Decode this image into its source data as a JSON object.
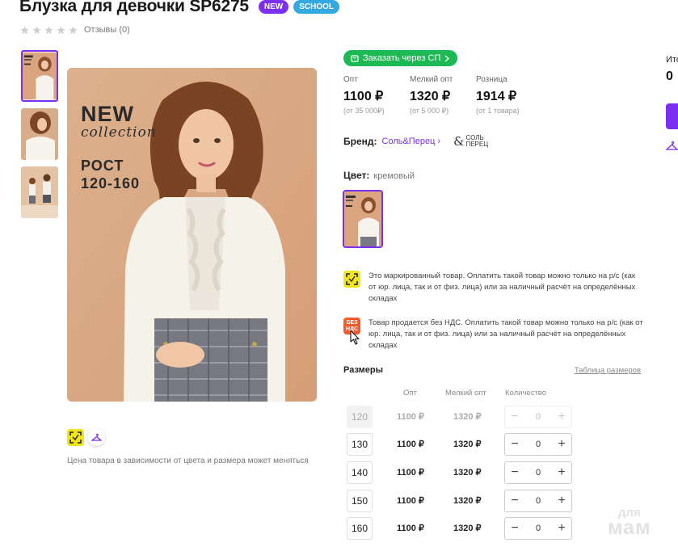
{
  "product": {
    "title": "Блузка для девочки SP6275",
    "badges": {
      "new": "NEW",
      "school": "SCHOOL"
    },
    "reviews": "Отзывы (0)",
    "rating": 0,
    "rating_max": 5
  },
  "photo": {
    "text_new": "NEW",
    "text_collection": "collection",
    "text_rost_1": "РОСТ",
    "text_rost_2": "120-160"
  },
  "gallery": {
    "thumbnail_count": 3,
    "active_index": 0
  },
  "price_note": "Цена товара в зависимости от цвета и размера может меняться",
  "sp_button": "Заказать через СП",
  "prices": [
    {
      "label": "Опт",
      "value": "1100 ₽",
      "sub": "(от 35 000₽)"
    },
    {
      "label": "Мелкий опт",
      "value": "1320 ₽",
      "sub": "(от 5 000 ₽)"
    },
    {
      "label": "Розница",
      "value": "1914 ₽",
      "sub": "(от 1 товара)"
    }
  ],
  "brand": {
    "label": "Бренд:",
    "name": "Соль&Перец",
    "logo_text_1": "СОЛЬ",
    "logo_text_2": "ПЕРЕЦ"
  },
  "color": {
    "label": "Цвет:",
    "value": "кремовый"
  },
  "notices": {
    "marked": "Это маркированный товар. Оплатить такой товар можно только на р/с (как от юр. лица, так и от физ. лица) или за наличный расчёт на определённых складах",
    "no_vat_icon_1": "БЕЗ",
    "no_vat_icon_2": "НДС",
    "no_vat": "Товар продается без НДС. Оплатить такой товар можно только на р/с (как от юр. лица, так и от физ. лица) или за наличный расчёт на определённых складах"
  },
  "sizes": {
    "title": "Размеры",
    "table_link": "Таблица размеров",
    "col_opt": "Опт",
    "col_melk": "Мелкий опт",
    "col_qty": "Количество",
    "rows": [
      {
        "size": "120",
        "opt": "1100 ₽",
        "melk": "1320 ₽",
        "qty": "0",
        "disabled": true
      },
      {
        "size": "130",
        "opt": "1100 ₽",
        "melk": "1320 ₽",
        "qty": "0",
        "disabled": false
      },
      {
        "size": "140",
        "opt": "1100 ₽",
        "melk": "1320 ₽",
        "qty": "0",
        "disabled": false
      },
      {
        "size": "150",
        "opt": "1100 ₽",
        "melk": "1320 ₽",
        "qty": "0",
        "disabled": false
      },
      {
        "size": "160",
        "opt": "1100 ₽",
        "melk": "1320 ₽",
        "qty": "0",
        "disabled": false
      }
    ]
  },
  "summary": {
    "itog_label": "Ито",
    "itog_value": "0"
  },
  "watermark": {
    "line1": "для",
    "line2": "мам"
  },
  "colors": {
    "accent": "#7b2ff0",
    "green": "#1db954",
    "school": "#34a8e0",
    "marker_yellow": "#f0e51b",
    "novat_red": "#f25a2c"
  }
}
